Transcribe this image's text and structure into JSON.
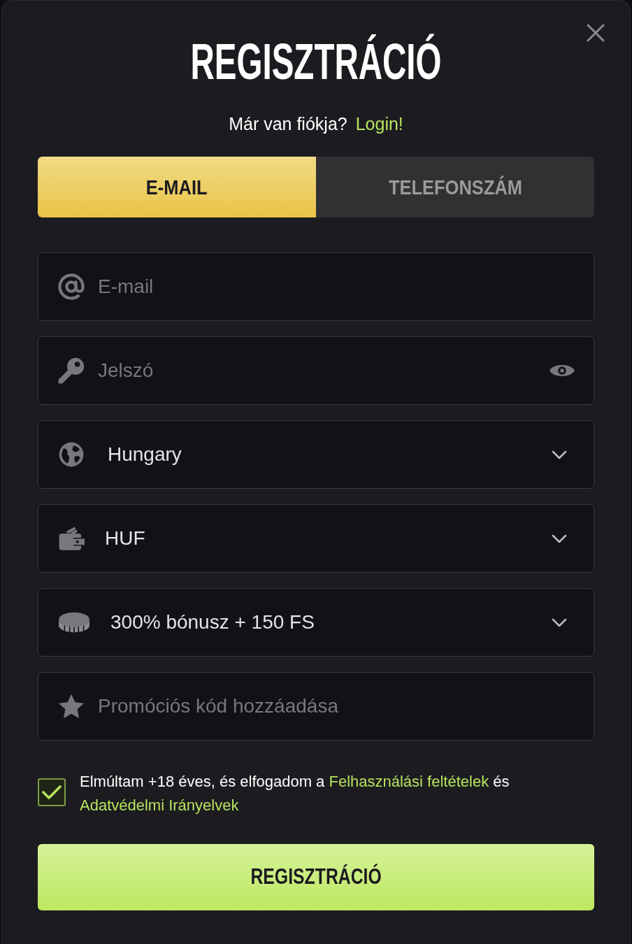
{
  "dialog": {
    "title": "REGISZTRÁCIÓ"
  },
  "login_prompt": {
    "text": "Már van fiókja?",
    "link": "Login!"
  },
  "tabs": [
    {
      "label": "E-MAIL",
      "selected": true
    },
    {
      "label": "TELEFONSZÁM",
      "selected": false
    }
  ],
  "fields": [
    {
      "kind": "email",
      "placeholder": "E-mail"
    },
    {
      "kind": "password",
      "placeholder": "Jelszó"
    },
    {
      "kind": "country",
      "value": "Hungary"
    },
    {
      "kind": "currency",
      "value": "HUF"
    },
    {
      "kind": "bonus",
      "value": "300% bónusz + 150 FS"
    },
    {
      "kind": "promo",
      "placeholder": "Promóciós kód hozzáadása"
    }
  ],
  "consent": {
    "checked": true,
    "text": "Elmúltam +18 éves, és elfogadom a",
    "terms_link": "Felhasználási feltételek",
    "joiner": "és",
    "privacy_link": "Adatvédelmi Irányelvek"
  },
  "submit_button": {
    "label": "REGISZTRÁCIÓ"
  }
}
